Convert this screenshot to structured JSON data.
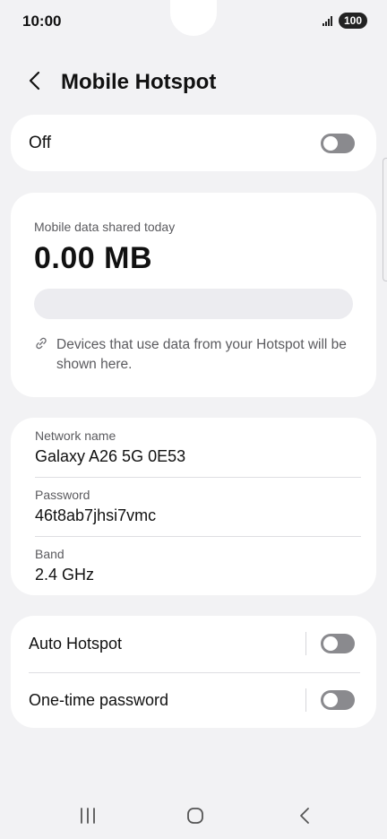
{
  "status_bar": {
    "time": "10:00",
    "battery": "100"
  },
  "header": {
    "title": "Mobile Hotspot",
    "back_icon": "chevron-left-icon"
  },
  "master_switch": {
    "label": "Off",
    "on": false
  },
  "usage": {
    "caption": "Mobile data shared today",
    "value": "0.00 MB",
    "bar_fraction": 0,
    "note_icon": "link-icon",
    "note": "Devices that use data from your Hotspot will be shown here."
  },
  "network": {
    "rows": [
      {
        "label": "Network name",
        "value": "Galaxy A26 5G 0E53"
      },
      {
        "label": "Password",
        "value": "46t8ab7jhsi7vmc"
      },
      {
        "label": "Band",
        "value": "2.4 GHz"
      }
    ]
  },
  "options": [
    {
      "label": "Auto Hotspot",
      "on": false
    },
    {
      "label": "One-time password",
      "on": false
    }
  ],
  "nav": {
    "recents": "recents-icon",
    "home": "home-icon",
    "back": "back-icon"
  },
  "colors": {
    "background": "#f2f2f4",
    "card": "#ffffff",
    "toggle_off": "#8a8a8e",
    "secondary_text": "#5b5b5f"
  }
}
